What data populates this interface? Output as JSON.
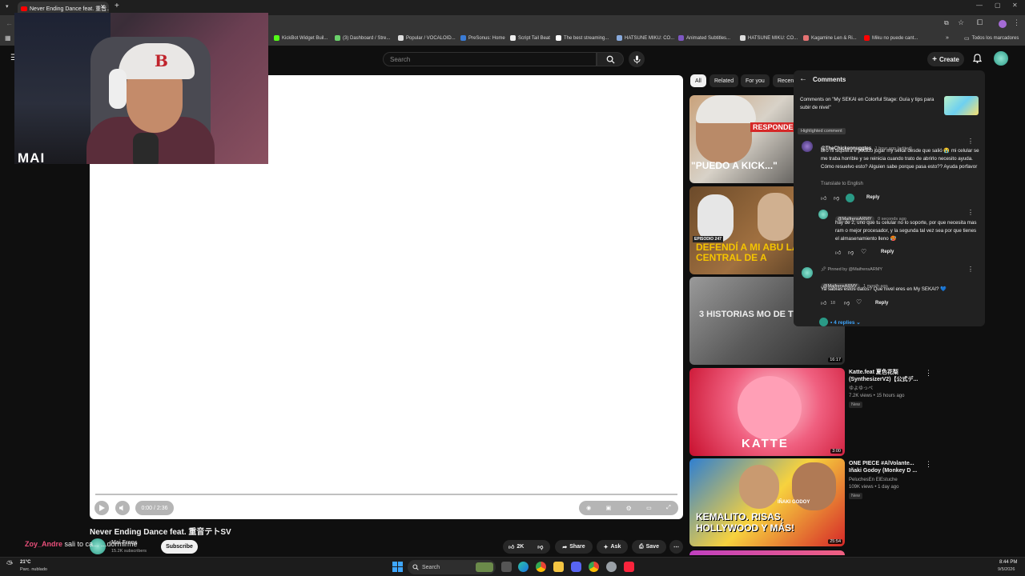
{
  "browser": {
    "tab_title": "Never Ending Dance feat. 重音...",
    "bookmarks": [
      "KickBot Widget Buil...",
      "(3) Dashboard / Stre...",
      "Popular / VOCALOID...",
      "PreSonus: Home",
      "Script Tail Beat",
      "The best streaming...",
      "HATSUNE MIKU: CO...",
      "Animated Subtitles...",
      "HATSUNE MIKU: CO...",
      "Kagamine Len & Ri...",
      "Miku no puede cant..."
    ],
    "bookmarks_all": "Todos los marcadores"
  },
  "header": {
    "search_placeholder": "Search",
    "create_label": "Create"
  },
  "webcam": {
    "overlay_text": "MAI",
    "cap_letter": "B"
  },
  "player": {
    "time": "0:00 / 2:36"
  },
  "chips": [
    "All",
    "Related",
    "For you",
    "Recent"
  ],
  "comments": {
    "header": "Comments",
    "context": "Comments on \"My SEKAI en Colorful Stage: Guía y tips para subir de nivel\"",
    "highlighted_label": "Highlighted comment",
    "c1": {
      "handle": "@TheChickennuggtes",
      "time": "1 hour ago (edited)",
      "text": "Bro ni siquiera e podido jugar my sekai desde que salió 😭 mi celular se me traba horrible y se reinicia cuando trato de abrirlo necesito ayuda. Cómo resuelvo esto? Alguien sabe porque pasa esto?? Ayuda porfavor",
      "translate": "Translate to English",
      "reply": "Reply"
    },
    "c2": {
      "handle": "@MaifrensARMY",
      "time": "0 seconds ago",
      "text": "hay de 2, uno que tu celular no lo soporte, por que necesita mas ram o mejor procesador, y la segunda tal vez sea por que tienes el almasenamiento lleno 🥵",
      "reply": "Reply"
    },
    "c3": {
      "pinned": "Pinned by @MaifrensARMY",
      "handle": "@MaifrensARMY",
      "time": "1 month ago",
      "text": "Ya sabías estos datos? Que nivel eres en My SEKAI? 💙",
      "likes": "18",
      "reply": "Reply",
      "replies": "4 replies"
    }
  },
  "sidebar_videos": [
    {
      "thumb_text": "\"PUEDO A KICK...\"",
      "thumb_text2": "RESPONDE",
      "colors": [
        "#c9a27b",
        "#2a2a2a"
      ]
    },
    {
      "thumb_text": "DEFENDÍ A MI ABU LA CENTRAL DE A",
      "thumb_text2": "EPISODIO 247",
      "colors": [
        "#f5c400",
        "#6b4a2a"
      ]
    },
    {
      "thumb_text": "3 HISTORIAS MO DE THERIANS",
      "duration": "16:17",
      "colors": [
        "#7a7a7a",
        "#3a3a3a"
      ]
    },
    {
      "thumb_text": "KATTE",
      "duration": "3:00",
      "title": "Katte.feat 夏色花梨 (SynthesizerV2)【公式デ...",
      "channel": "ゆよゆっぺ",
      "meta": "7.2K views • 15 hours ago",
      "badge": "New",
      "colors": [
        "#e8344e",
        "#ffd1dc"
      ]
    },
    {
      "thumb_text": "KEMALITO. RISAS, HOLLYWOOD Y MÁS!",
      "thumb_text2": "IÑAKI GODOY",
      "duration": "25:54",
      "title": "ONE PIECE #AlVolante... Iñaki Godoy (Monkey D ...",
      "channel": "PeluchesEn ElEstuche",
      "meta": "109K views • 1 day ago",
      "badge": "New",
      "colors": [
        "#2f7fd1",
        "#f7d23e"
      ]
    }
  ],
  "video": {
    "title": "Never Ending Dance feat. 重音テトSV",
    "channel": "Mai Frens",
    "subscribers": "15.2K subscribers",
    "subscribe": "Subscribe",
    "likes": "2K",
    "share": "Share",
    "ask": "Ask",
    "save": "Save",
    "chat_user": "Zoy_Andre",
    "chat_msg": "sali to ca... ...dormirme"
  },
  "taskbar": {
    "weather_temp": "21°C",
    "weather_desc": "Parc. nublado",
    "search": "Search",
    "time": "8:44 PM",
    "date": "9/5/2026"
  },
  "colors": {
    "bg": "#0f0f0f",
    "panel": "#212121",
    "brand_red": "#ff0000",
    "chip_active": "#f1f1f1"
  }
}
